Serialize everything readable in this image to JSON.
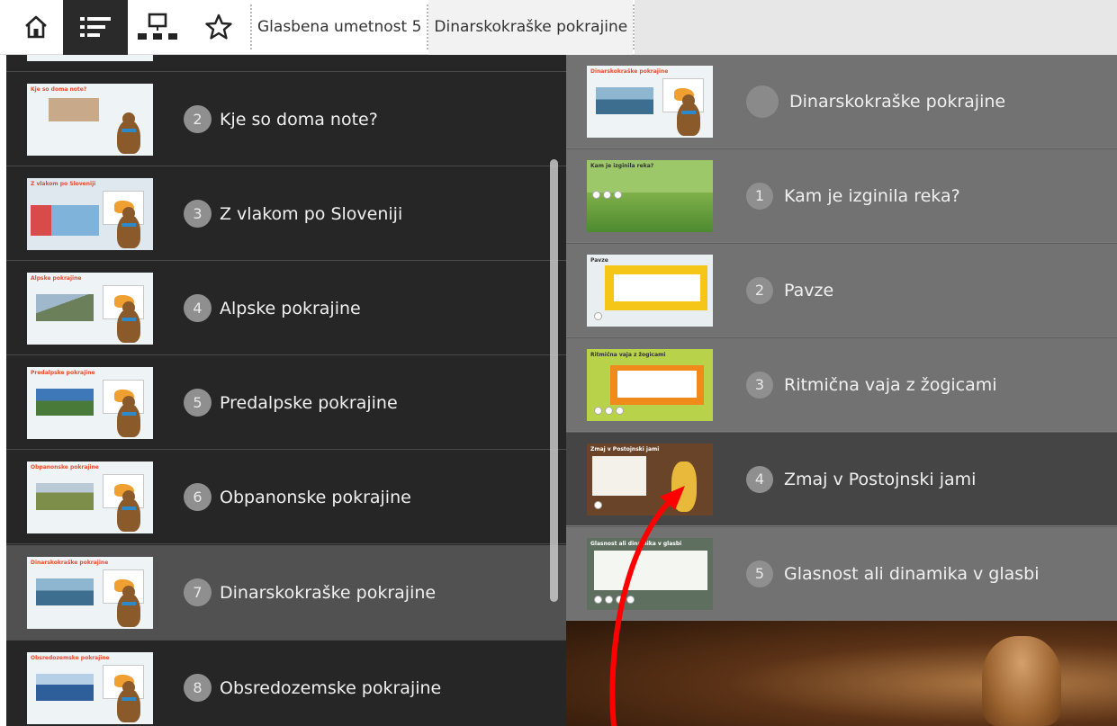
{
  "toolbar": {
    "home_icon": "home-icon",
    "toc_icon": "table-of-contents-icon",
    "map_icon": "sitemap-icon",
    "star_icon": "star-icon",
    "breadcrumb": [
      "Glasbena umetnost 5",
      "Dinarskokraške pokrajine"
    ]
  },
  "left_panel": {
    "items": [
      {
        "number": "2",
        "label": "Kje so doma note?",
        "thumb_title": "Kje so doma note?"
      },
      {
        "number": "3",
        "label": "Z vlakom po Sloveniji",
        "thumb_title": "Z vlakom po Sloveniji"
      },
      {
        "number": "4",
        "label": "Alpske pokrajine",
        "thumb_title": "Alpske pokrajine"
      },
      {
        "number": "5",
        "label": "Predalpske pokrajine",
        "thumb_title": "Predalpske pokrajine"
      },
      {
        "number": "6",
        "label": "Obpanonske pokrajine",
        "thumb_title": "Obpanonske pokrajine"
      },
      {
        "number": "7",
        "label": "Dinarskokraške pokrajine",
        "thumb_title": "Dinarskokraške pokrajine"
      },
      {
        "number": "8",
        "label": "Obsredozemske pokrajine",
        "thumb_title": "Obsredozemske pokrajine"
      }
    ],
    "active_index": 5
  },
  "right_panel": {
    "header": {
      "label": "Dinarskokraške pokrajine",
      "thumb_title": "Dinarskokraške pokrajine"
    },
    "items": [
      {
        "number": "1",
        "label": "Kam je izginila reka?",
        "thumb_title": "Kam je izginila reka?"
      },
      {
        "number": "2",
        "label": "Pavze",
        "thumb_title": "Pavze"
      },
      {
        "number": "3",
        "label": "Ritmična vaja z žogicami",
        "thumb_title": "Ritmična vaja z žogicami"
      },
      {
        "number": "4",
        "label": "Zmaj v Postojnski jami",
        "thumb_title": "Zmaj v Postojnski jami"
      },
      {
        "number": "5",
        "label": "Glasnost ali dinamika v glasbi",
        "thumb_title": "Glasnost ali dinamika v glasbi"
      }
    ],
    "highlighted_index": 3
  },
  "colors": {
    "left_bg": "#262626",
    "left_active": "#515151",
    "right_bg": "#5c5c5c",
    "badge": "#8f8f8f",
    "annotation_arrow": "#ff0000"
  }
}
